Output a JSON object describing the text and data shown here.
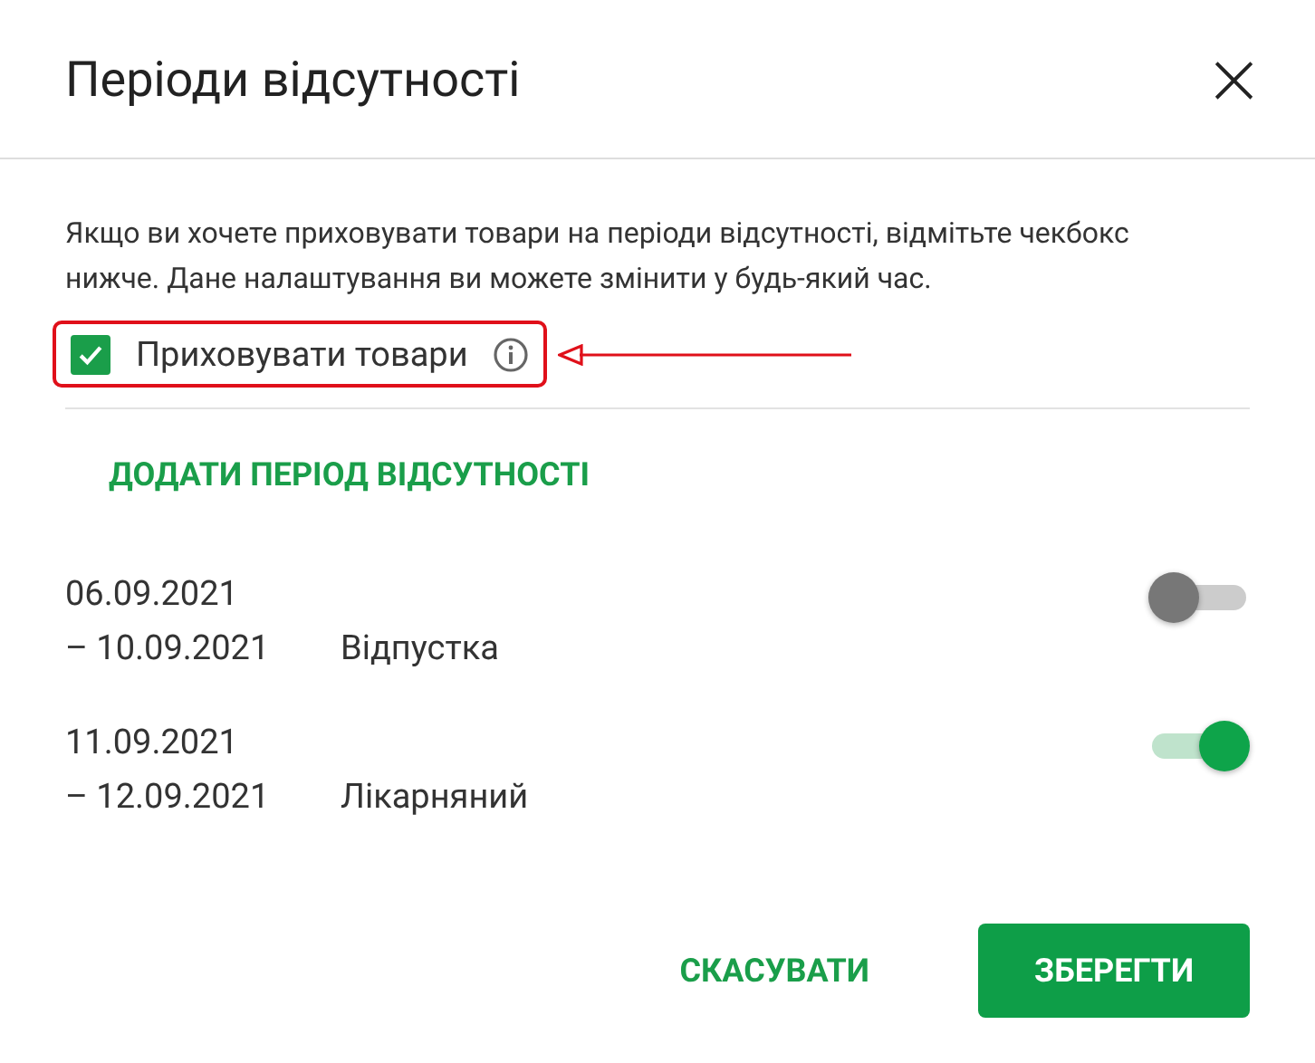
{
  "dialog": {
    "title": "Періоди відсутності",
    "close": "×"
  },
  "description": "Якщо ви хочете приховувати товари на періоди відсутності, відмітьте чекбокс нижче. Дане налаштування ви можете змінити у будь-який час.",
  "hide_products": {
    "label": "Приховувати товари",
    "checked": true,
    "highlighted": true
  },
  "add_period": "ДОДАТИ ПЕРІОД ВІДСУТНОСТІ",
  "periods": [
    {
      "start": "06.09.2021",
      "end": "– 10.09.2021",
      "reason": "Відпустка",
      "on": false
    },
    {
      "start": "11.09.2021",
      "end": "– 12.09.2021",
      "reason": "Лікарняний",
      "on": true
    }
  ],
  "buttons": {
    "cancel": "СКАСУВАТИ",
    "save": "ЗБЕРЕГТИ"
  }
}
